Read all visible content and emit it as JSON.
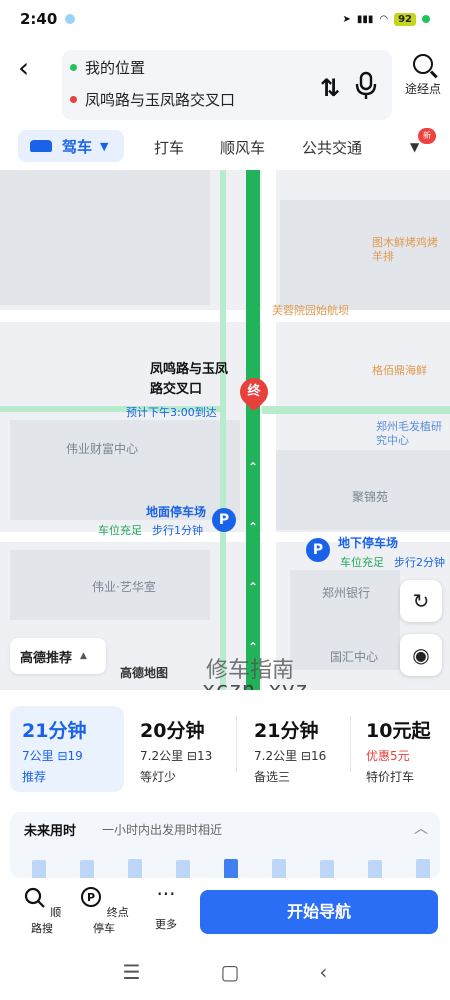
{
  "status_bar": {
    "time": "2:40",
    "battery": "92"
  },
  "search": {
    "origin": "我的位置",
    "destination": "凤鸣路与玉凤路交叉口",
    "waypoint_label": "途经点"
  },
  "modes": {
    "drive": "驾车",
    "items": [
      "打车",
      "顺风车",
      "公共交通"
    ],
    "new_badge": "新"
  },
  "map": {
    "destination_name": "凤鸣路与玉凤路交叉口",
    "end_marker": "终",
    "eta": "预计下午3:00到达",
    "labels": [
      "伟业财富中心",
      "伟业·艺华室",
      "聚锦苑",
      "国汇中心",
      "郑州银行"
    ],
    "pois_orange": [
      "图木鲜烤鸡烤羊排",
      "芙蓉院园始航坝",
      "格佰鼎海鲜"
    ],
    "pois_blue": [
      "郑州毛发植研究中心"
    ],
    "parking": [
      {
        "title": "地面停车场",
        "status": "车位充足",
        "walk": "步行1分钟"
      },
      {
        "title": "地下停车场",
        "status": "车位充足",
        "walk": "步行2分钟"
      }
    ],
    "recommend": "高德推荐",
    "logo": "高德地图",
    "watermark_line1": "修车指南",
    "watermark_line2": "xczn.xyz"
  },
  "options": [
    {
      "time": "21分钟",
      "dist": "7公里",
      "lights": "19",
      "tag": "推荐",
      "selected": true
    },
    {
      "time": "20分钟",
      "dist": "7.2公里",
      "lights": "13",
      "tag": "等灯少"
    },
    {
      "time": "21分钟",
      "dist": "7.2公里",
      "lights": "16",
      "tag": "备选三"
    },
    {
      "time": "10元起",
      "discount": "优惠5元",
      "tag": "特价打车"
    }
  ],
  "future": {
    "title": "未来用时",
    "desc": "一小时内出发用时相近",
    "bars": [
      0.55,
      0.55,
      0.6,
      0.55,
      0.6,
      0.6,
      0.55,
      0.55,
      0.6
    ],
    "current_index": 4
  },
  "actions": {
    "along_search": "顺路搜",
    "end_parking": "终点停车",
    "more": "更多",
    "start": "开始导航"
  },
  "colors": {
    "accent": "#2a6ef5",
    "route_green": "#22b25a",
    "end_red": "#e8413c"
  }
}
